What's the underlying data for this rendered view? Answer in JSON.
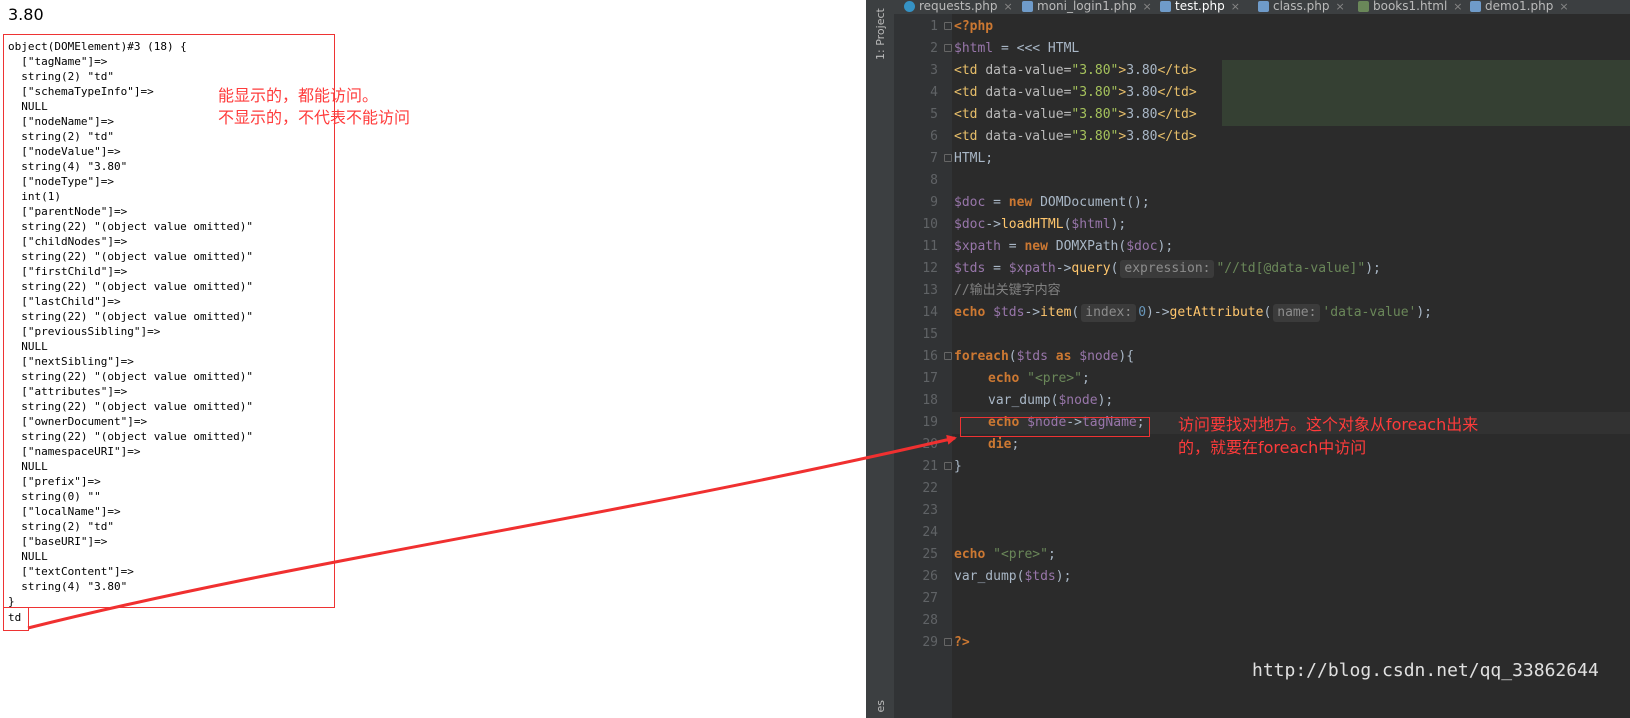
{
  "output": {
    "first_line": "3.80",
    "dump_lines": [
      "object(DOMElement)#3 (18) {",
      "  [\"tagName\"]=>",
      "  string(2) \"td\"",
      "  [\"schemaTypeInfo\"]=>",
      "  NULL",
      "  [\"nodeName\"]=>",
      "  string(2) \"td\"",
      "  [\"nodeValue\"]=>",
      "  string(4) \"3.80\"",
      "  [\"nodeType\"]=>",
      "  int(1)",
      "  [\"parentNode\"]=>",
      "  string(22) \"(object value omitted)\"",
      "  [\"childNodes\"]=>",
      "  string(22) \"(object value omitted)\"",
      "  [\"firstChild\"]=>",
      "  string(22) \"(object value omitted)\"",
      "  [\"lastChild\"]=>",
      "  string(22) \"(object value omitted)\"",
      "  [\"previousSibling\"]=>",
      "  NULL",
      "  [\"nextSibling\"]=>",
      "  string(22) \"(object value omitted)\"",
      "  [\"attributes\"]=>",
      "  string(22) \"(object value omitted)\"",
      "  [\"ownerDocument\"]=>",
      "  string(22) \"(object value omitted)\"",
      "  [\"namespaceURI\"]=>",
      "  NULL",
      "  [\"prefix\"]=>",
      "  string(0) \"\"",
      "  [\"localName\"]=>",
      "  string(2) \"td\"",
      "  [\"baseURI\"]=>",
      "  NULL",
      "  [\"textContent\"]=>",
      "  string(4) \"3.80\"",
      "}"
    ],
    "last_line": "td"
  },
  "annotations": {
    "left_line1": "能显示的，都能访问。",
    "left_line2": "不显示的，不代表不能访问",
    "right_line1": "访问要找对地方。这个对象从foreach出来",
    "right_line2": "的，就要在foreach中访问"
  },
  "ide": {
    "side_label": "1: Project",
    "side_bottom": "es",
    "tabs": [
      {
        "label": "requests.php",
        "icon": "c-icon",
        "active": false
      },
      {
        "label": "moni_login1.php",
        "icon": "php-icon",
        "active": false
      },
      {
        "label": "test.php",
        "icon": "php-icon",
        "active": true
      },
      {
        "label": "class.php",
        "icon": "php-icon",
        "active": false
      },
      {
        "label": "books1.html",
        "icon": "html-icon",
        "active": false
      },
      {
        "label": "demo1.php",
        "icon": "php-icon",
        "active": false
      }
    ],
    "close_glyph": "×",
    "line_numbers": [
      "1",
      "2",
      "3",
      "4",
      "5",
      "6",
      "7",
      "8",
      "9",
      "10",
      "11",
      "12",
      "13",
      "14",
      "15",
      "16",
      "17",
      "18",
      "19",
      "20",
      "21",
      "22",
      "23",
      "24",
      "25",
      "26",
      "27",
      "28",
      "29"
    ],
    "code": {
      "l1": "<?php",
      "l2_var": "$html",
      "l2_rest": " = <<< HTML",
      "td_open": "<td ",
      "td_attr": "data-value=",
      "td_attrval": "\"3.80\"",
      "td_gt": ">",
      "td_text": "3.80",
      "td_close": "</td>",
      "l7": "HTML;",
      "l9_var": "$doc",
      "l9_eq": " = ",
      "l9_kw": "new",
      "l9_rest": " DOMDocument();",
      "l10_var": "$doc",
      "l10_arrow": "->",
      "l10_fn": "loadHTML",
      "l10_open": "(",
      "l10_arg": "$html",
      "l10_close": ");",
      "l11_var": "$xpath",
      "l11_eq": " = ",
      "l11_kw": "new",
      "l11_cls": " DOMXPath(",
      "l11_arg": "$doc",
      "l11_close": ");",
      "l12_var": "$tds",
      "l12_eq": " = ",
      "l12_var2": "$xpath",
      "l12_arrow": "->",
      "l12_fn": "query",
      "l12_open": "(",
      "l12_hint": "expression:",
      "l12_str": "\"//td[@data-value]\"",
      "l12_close": ");",
      "l13": "//输出关键字内容",
      "l14_kw": "echo",
      "l14_var": " $tds",
      "l14_arrow": "->",
      "l14_fn": "item",
      "l14_open": "(",
      "l14_hint": "index:",
      "l14_num": "0",
      "l14_mid": ")->",
      "l14_fn2": "getAttribute",
      "l14_open2": "(",
      "l14_hint2": "name:",
      "l14_str": "'data-value'",
      "l14_close": ");",
      "l16_kw": "foreach",
      "l16_open": "(",
      "l16_var": "$tds",
      "l16_as": " as ",
      "l16_var2": "$node",
      "l16_close": "){",
      "l17_kw": "echo",
      "l17_str": " \"<pre>\"",
      "l17_semi": ";",
      "l18_fn": "var_dump(",
      "l18_var": "$node",
      "l18_close": ");",
      "l19_kw": "echo",
      "l19_var": " $node",
      "l19_arrow": "->",
      "l19_prop": "tagName",
      "l19_semi": ";",
      "l20_kw": "die",
      "l20_semi": ";",
      "l21": "}",
      "l25_kw": "echo",
      "l25_str": " \"<pre>\"",
      "l25_semi": ";",
      "l26_fn": "var_dump(",
      "l26_var": "$tds",
      "l26_close": ");",
      "l29": "?>"
    }
  },
  "watermark": "http://blog.csdn.net/qq_33862644",
  "colors": {
    "annotation_red": "#ff3b3b",
    "box_red": "#ee3333",
    "arrow_red": "#f03030"
  }
}
